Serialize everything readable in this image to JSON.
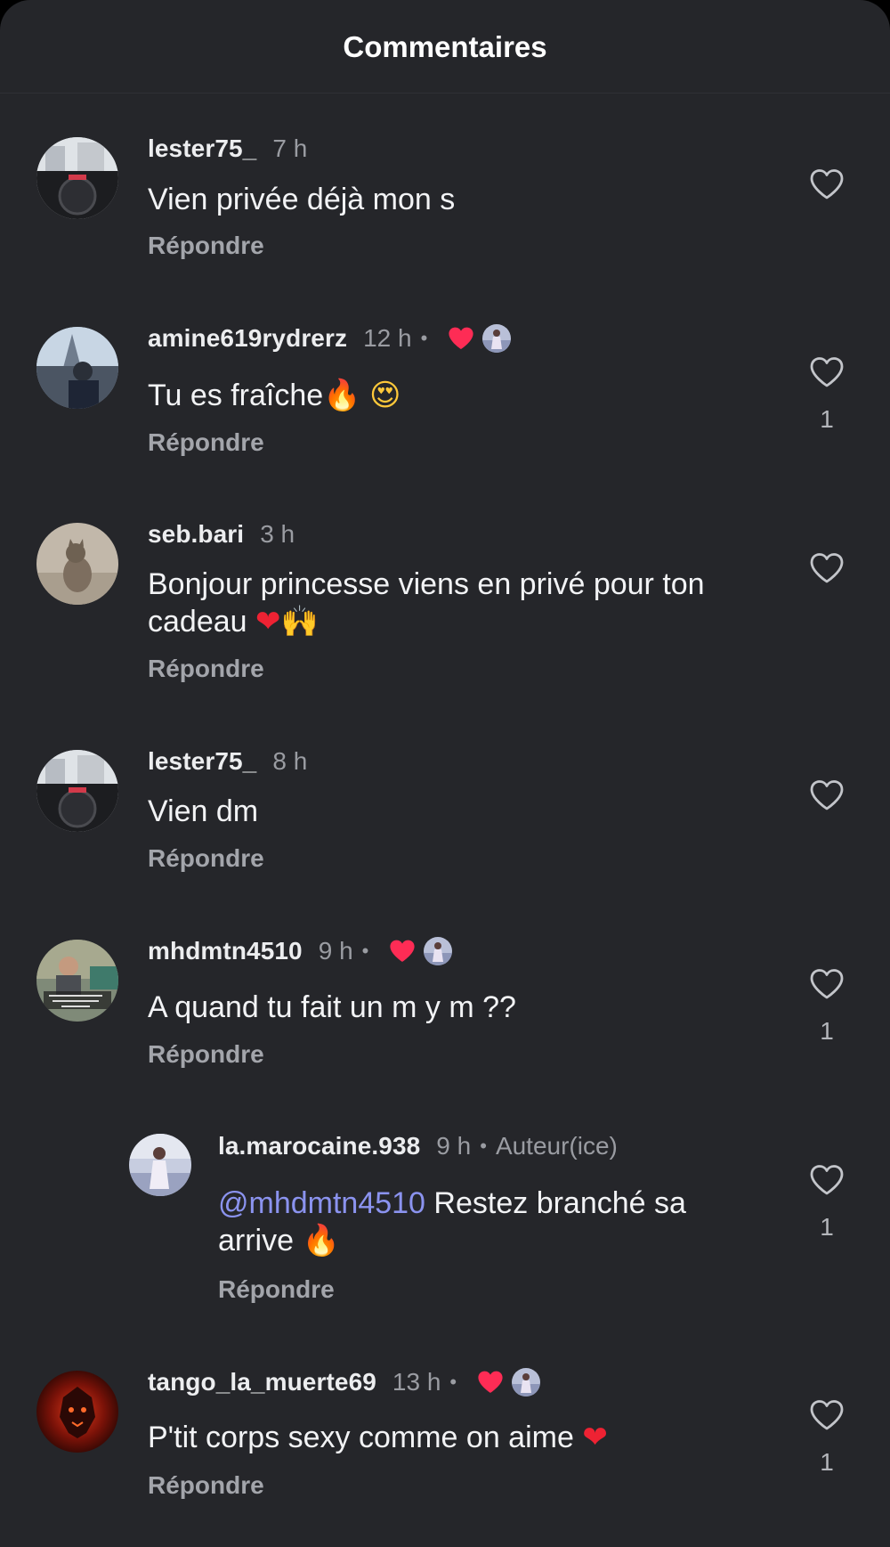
{
  "header": {
    "title": "Commentaires"
  },
  "reply_label": "Répondre",
  "comments": [
    {
      "username": "lester75_",
      "time": "7 h",
      "text": "Vien privée déjà mon s",
      "likes": ""
    },
    {
      "username": "amine619rydrerz",
      "time": "12 h",
      "dot": "•",
      "text": "Tu es fraîche",
      "emoji_1": "🔥",
      "emoji_2": "😍",
      "likes": "1",
      "author_liked": true
    },
    {
      "username": "seb.bari",
      "time": "3 h",
      "text": "Bonjour princesse viens en privé pour ton cadeau",
      "emoji_1": "❤",
      "emoji_2": "🙌",
      "likes": ""
    },
    {
      "username": "lester75_",
      "time": "8 h",
      "text": "Vien dm",
      "likes": ""
    },
    {
      "username": "mhdmtn4510",
      "time": "9 h",
      "dot": "•",
      "text": "A quand tu fait un m y m ??",
      "likes": "1",
      "author_liked": true
    },
    {
      "username": "la.marocaine.938",
      "time": "9 h",
      "dot": "•",
      "author_badge": "Auteur(ice)",
      "mention": "@mhdmtn4510",
      "text": " Restez branché sa arrive ",
      "emoji_1": "🔥",
      "likes": "1",
      "is_reply": true
    },
    {
      "username": "tango_la_muerte69",
      "time": "13 h",
      "dot": "•",
      "text": "P'tit corps sexy comme on aime ",
      "emoji_1": "❤",
      "likes": "1",
      "author_liked": true
    }
  ],
  "colors": {
    "background": "#25262a",
    "mention": "#8b93ef",
    "liked_heart": "#fe2c55"
  }
}
